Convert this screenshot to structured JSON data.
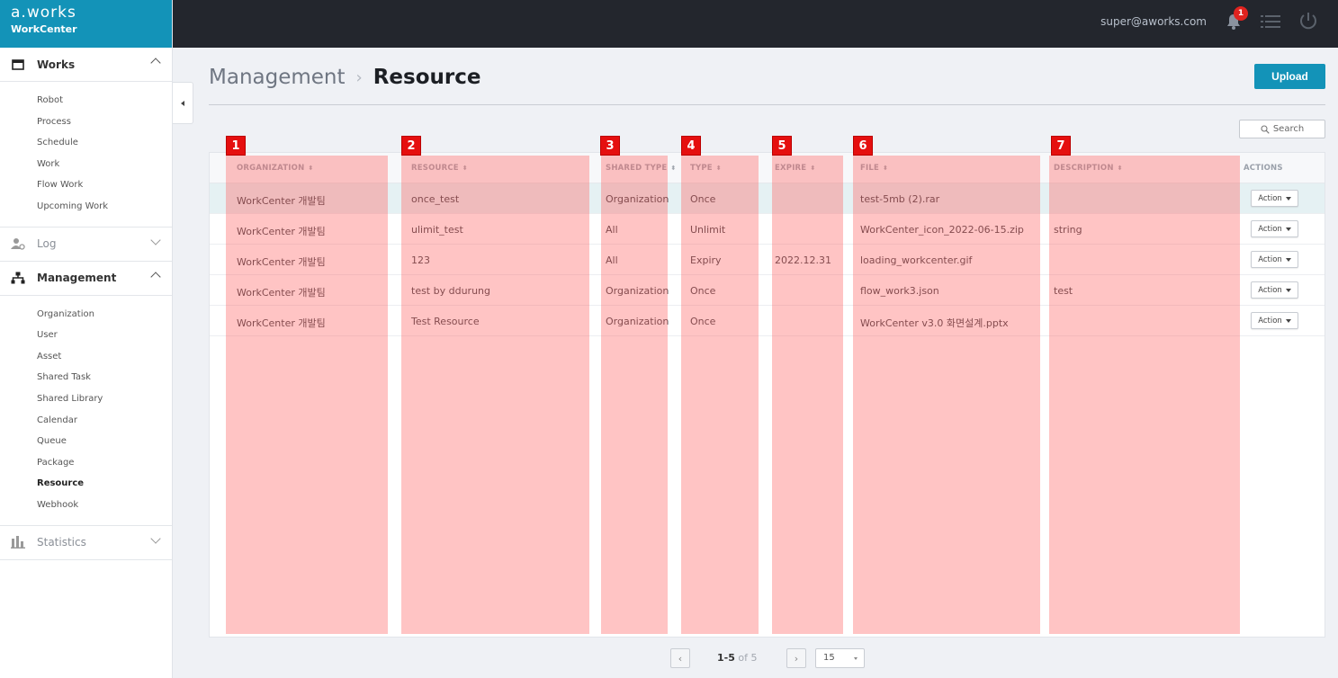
{
  "brand": {
    "logo": "a.works",
    "product": "WorkCenter"
  },
  "topbar": {
    "user_email": "super@aworks.com",
    "notification_count": "1"
  },
  "sidebar": {
    "groups": [
      {
        "label": "Works",
        "icon": "calendar-icon",
        "expanded": true,
        "items": [
          "Robot",
          "Process",
          "Schedule",
          "Work",
          "Flow Work",
          "Upcoming Work"
        ]
      },
      {
        "label": "Log",
        "icon": "user-log-icon",
        "expanded": false,
        "items": []
      },
      {
        "label": "Management",
        "icon": "org-chart-icon",
        "expanded": true,
        "items": [
          "Organization",
          "User",
          "Asset",
          "Shared Task",
          "Shared Library",
          "Calendar",
          "Queue",
          "Package",
          "Resource",
          "Webhook"
        ],
        "active_item": "Resource"
      },
      {
        "label": "Statistics",
        "icon": "bar-chart-icon",
        "expanded": false,
        "items": []
      }
    ]
  },
  "page": {
    "breadcrumb": "Management",
    "separator": "›",
    "title": "Resource",
    "upload_label": "Upload",
    "search_label": "Search"
  },
  "table": {
    "columns": [
      "ORGANIZATION",
      "RESOURCE",
      "SHARED TYPE",
      "TYPE",
      "EXPIRE",
      "FILE",
      "DESCRIPTION",
      "ACTIONS"
    ],
    "action_label": "Action",
    "rows": [
      {
        "organization": "WorkCenter 개발팀",
        "resource": "once_test",
        "shared_type": "Organization",
        "type": "Once",
        "expire": "",
        "file": "test-5mb (2).rar",
        "description": ""
      },
      {
        "organization": "WorkCenter 개발팀",
        "resource": "ulimit_test",
        "shared_type": "All",
        "type": "Unlimit",
        "expire": "",
        "file": "WorkCenter_icon_2022-06-15.zip",
        "description": "string"
      },
      {
        "organization": "WorkCenter 개발팀",
        "resource": "123",
        "shared_type": "All",
        "type": "Expiry",
        "expire": "2022.12.31",
        "file": "loading_workcenter.gif",
        "description": ""
      },
      {
        "organization": "WorkCenter 개발팀",
        "resource": "test by ddurung",
        "shared_type": "Organization",
        "type": "Once",
        "expire": "",
        "file": "flow_work3.json",
        "description": "test"
      },
      {
        "organization": "WorkCenter 개발팀",
        "resource": "Test Resource",
        "shared_type": "Organization",
        "type": "Once",
        "expire": "",
        "file": "WorkCenter v3.0 화면설계.pptx",
        "description": ""
      }
    ]
  },
  "annotations": [
    "1",
    "2",
    "3",
    "4",
    "5",
    "6",
    "7"
  ],
  "pagination": {
    "range": "1-5",
    "of_label": "of",
    "total": "5",
    "page_size": "15"
  },
  "colors": {
    "brand": "#1393b8",
    "topbar": "#23262d",
    "highlight_overlay": "#ff6464",
    "badge": "#e0231f"
  }
}
